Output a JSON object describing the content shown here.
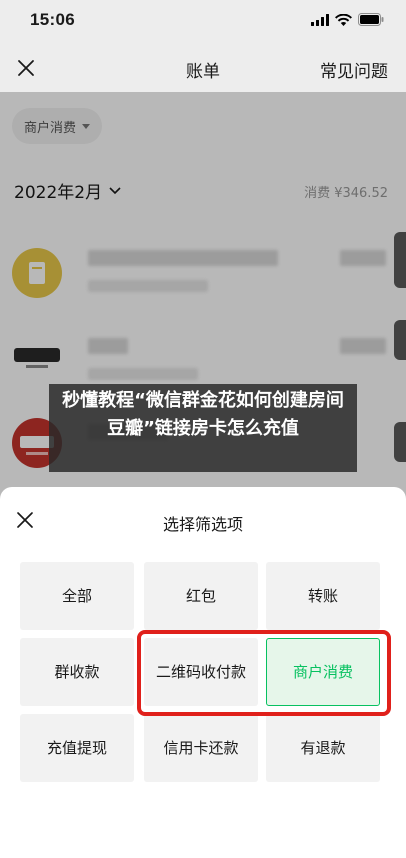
{
  "status_bar": {
    "time": "15:06"
  },
  "nav": {
    "title": "账单",
    "right_link": "常见问题"
  },
  "page": {
    "filter_chip": "商户消费",
    "month": "2022年2月",
    "month_total": "消费 ¥346.52"
  },
  "caption": {
    "text": "秒懂教程“微信群金花如何创建房间豆瓣”链接房卡怎么充值"
  },
  "sheet": {
    "title": "选择筛选项",
    "options": [
      {
        "label": "全部"
      },
      {
        "label": "红包"
      },
      {
        "label": "转账"
      },
      {
        "label": "群收款"
      },
      {
        "label": "二维码收付款"
      },
      {
        "label": "商户消费",
        "selected": true
      },
      {
        "label": "充值提现"
      },
      {
        "label": "信用卡还款"
      },
      {
        "label": "有退款"
      }
    ]
  },
  "colors": {
    "accent": "#07c160",
    "highlight": "#e0201b",
    "nav_bg": "#ededed"
  },
  "icons": [
    "close-icon",
    "chevron-down-icon",
    "caret-down-icon",
    "signal-icon",
    "wifi-icon",
    "battery-icon"
  ]
}
